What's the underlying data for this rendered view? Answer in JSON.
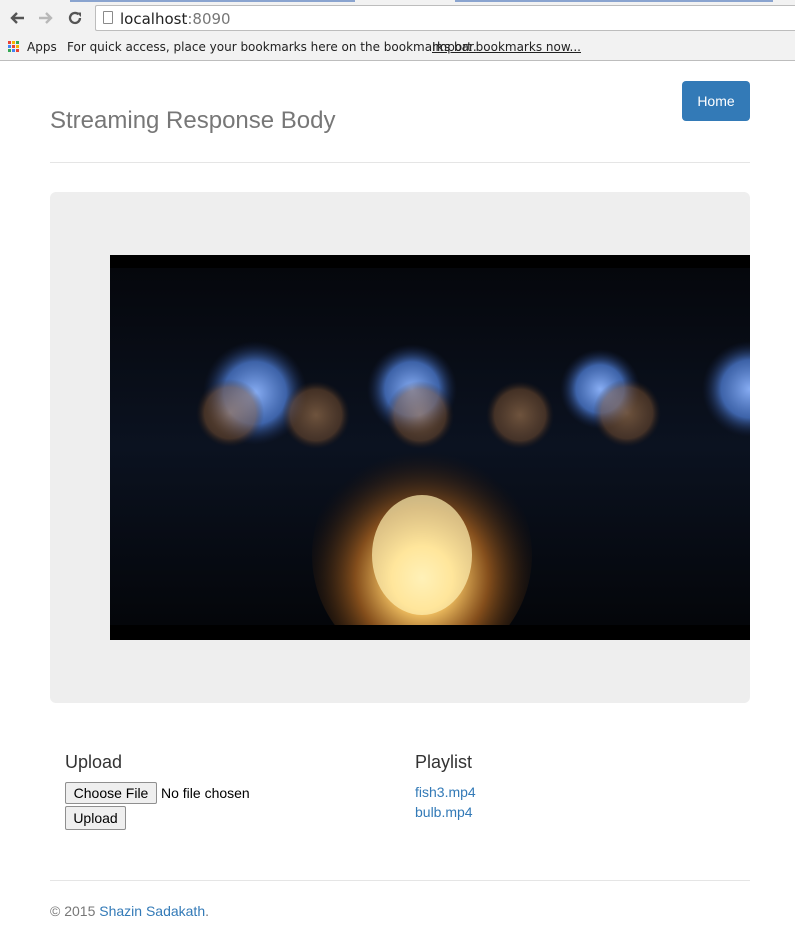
{
  "browser": {
    "url_host": "localhost",
    "url_port": ":8090",
    "bookmarks_apps": "Apps",
    "bookmarks_hint": "For quick access, place your bookmarks here on the bookmarks bar.",
    "bookmarks_import": "Import bookmarks now..."
  },
  "header": {
    "title": "Streaming Response Body",
    "home_label": "Home"
  },
  "upload": {
    "title": "Upload",
    "choose_label": "Choose File",
    "file_status": "No file chosen",
    "submit_label": "Upload"
  },
  "playlist": {
    "title": "Playlist",
    "items": [
      "fish3.mp4",
      "bulb.mp4"
    ]
  },
  "footer": {
    "copyright": "© 2015 ",
    "author": "Shazin Sadakath",
    "suffix": "."
  },
  "colors": {
    "primary": "#337ab7",
    "jumbotron_bg": "#eeeeee"
  }
}
